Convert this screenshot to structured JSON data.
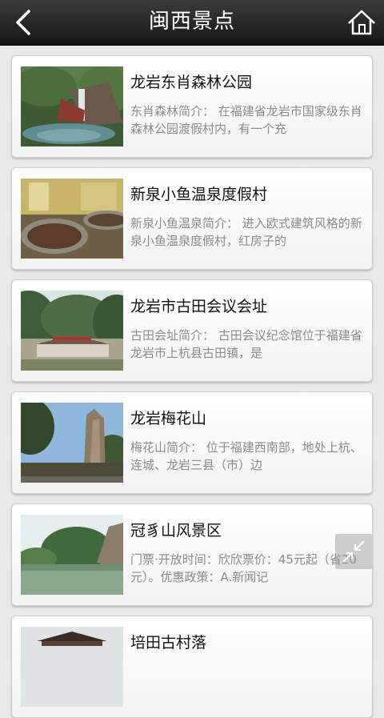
{
  "header": {
    "title": "闽西景点",
    "back_icon": "back-arrow-icon",
    "home_icon": "home-icon"
  },
  "items": [
    {
      "title": "龙岩东肖森林公园",
      "desc": "东肖森林简介： 在福建省龙岩市国家级东肖森林公园渡假村内，有一个充"
    },
    {
      "title": "新泉小鱼温泉度假村",
      "desc": "新泉小鱼温泉简介： 进入欧式建筑风格的新泉小鱼温泉度假村，红房子的"
    },
    {
      "title": "龙岩市古田会议会址",
      "desc": "古田会址简介： 古田会议纪念馆位于福建省龙岩市上杭县古田镇，是"
    },
    {
      "title": "龙岩梅花山",
      "desc": "梅花山简介： 位于福建西南部，地处上杭、连城、龙岩三县（市）边"
    },
    {
      "title": "冠豸山风景区",
      "desc": "门票·开放时间：欣欣票价：45元起（省20元）。优惠政策：A.新闻记"
    },
    {
      "title": "培田古村落",
      "desc": ""
    }
  ],
  "float_button_icon": "collapse-icon"
}
